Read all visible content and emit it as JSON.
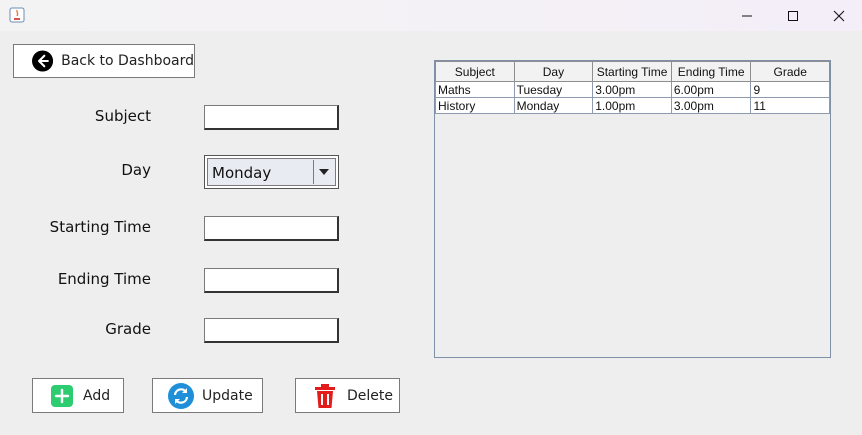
{
  "window": {
    "minimize": "minimize",
    "maximize": "maximize",
    "close": "close"
  },
  "nav": {
    "back_label": "Back to Dashboard"
  },
  "form": {
    "subject_label": "Subject",
    "subject_value": "",
    "day_label": "Day",
    "day_value": "Monday",
    "start_label": "Starting Time",
    "start_value": "",
    "end_label": "Ending Time",
    "end_value": "",
    "grade_label": "Grade",
    "grade_value": ""
  },
  "actions": {
    "add_label": "Add",
    "update_label": "Update",
    "delete_label": "Delete"
  },
  "table": {
    "columns": [
      "Subject",
      "Day",
      "Starting Time",
      "Ending Time",
      "Grade"
    ],
    "rows": [
      [
        "Maths",
        "Tuesday",
        "3.00pm",
        "6.00pm",
        "9"
      ],
      [
        "History",
        "Monday",
        "1.00pm",
        "3.00pm",
        "11"
      ]
    ]
  },
  "colors": {
    "add_icon": "#2ecc71",
    "update_icon": "#1e8fd8",
    "delete_icon": "#e21b1b"
  }
}
